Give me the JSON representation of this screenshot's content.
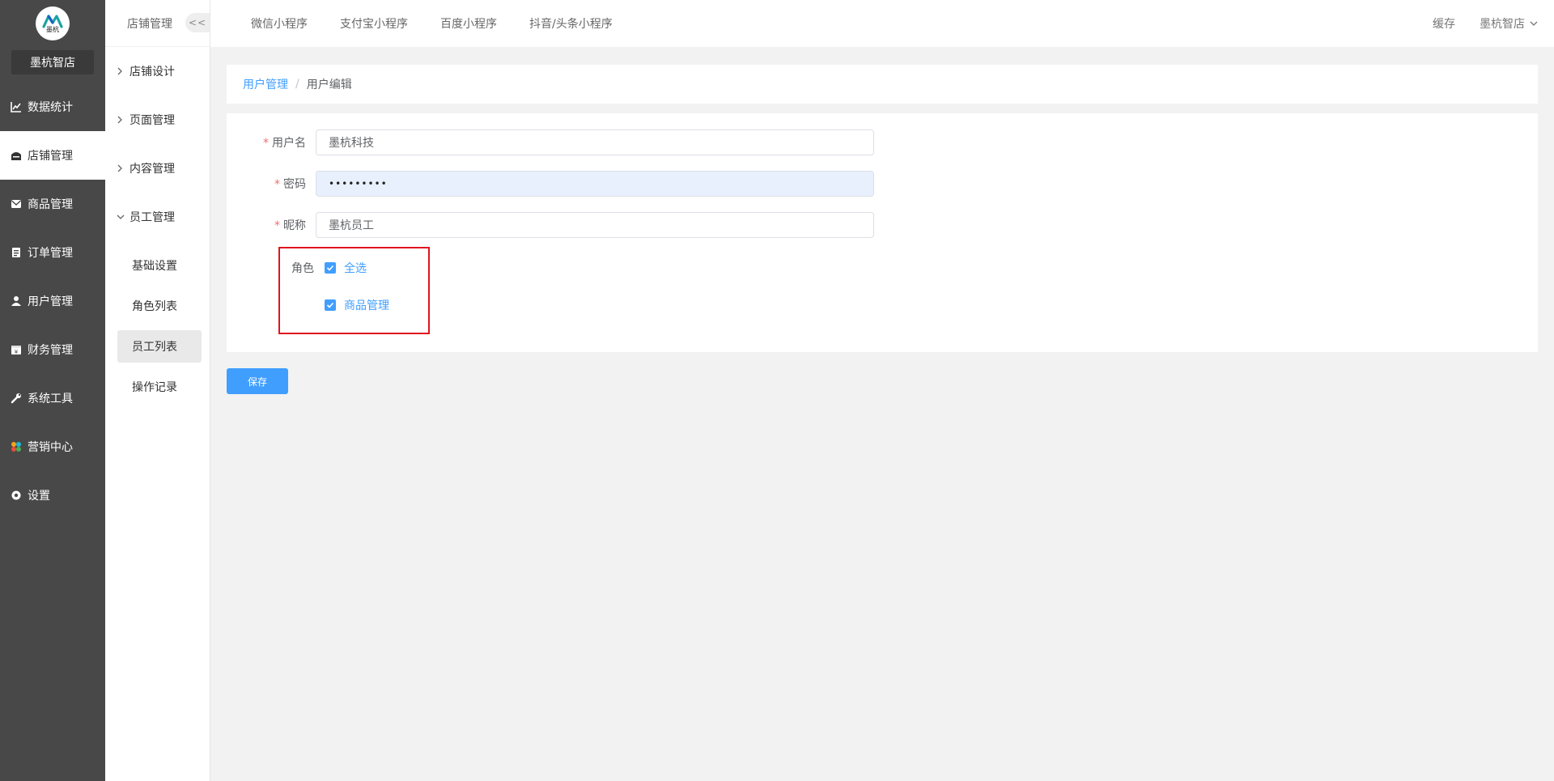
{
  "brand": {
    "logo_text": "墨杭",
    "shop_name": "墨杭智店"
  },
  "sidebar": {
    "items": [
      {
        "label": "数据统计",
        "icon": "chart-line-icon"
      },
      {
        "label": "店铺管理",
        "icon": "store-icon",
        "active": true
      },
      {
        "label": "商品管理",
        "icon": "envelope-icon"
      },
      {
        "label": "订单管理",
        "icon": "clipboard-icon"
      },
      {
        "label": "用户管理",
        "icon": "user-icon"
      },
      {
        "label": "财务管理",
        "icon": "finance-icon"
      },
      {
        "label": "系统工具",
        "icon": "wrench-icon"
      },
      {
        "label": "营销中心",
        "icon": "marketing-icon"
      },
      {
        "label": "设置",
        "icon": "gear-icon"
      }
    ]
  },
  "subbar": {
    "title": "店铺管理",
    "collapse_label": "<<",
    "groups": [
      {
        "label": "店铺设计",
        "expanded": false
      },
      {
        "label": "页面管理",
        "expanded": false
      },
      {
        "label": "内容管理",
        "expanded": false
      },
      {
        "label": "员工管理",
        "expanded": true
      }
    ],
    "children": [
      {
        "label": "基础设置"
      },
      {
        "label": "角色列表"
      },
      {
        "label": "员工列表",
        "active": true
      },
      {
        "label": "操作记录"
      }
    ]
  },
  "topbar": {
    "tabs": [
      "微信小程序",
      "支付宝小程序",
      "百度小程序",
      "抖音/头条小程序"
    ],
    "cache_label": "缓存",
    "user_label": "墨杭智店"
  },
  "breadcrumb": {
    "parent": "用户管理",
    "separator": "/",
    "current": "用户编辑"
  },
  "form": {
    "username": {
      "label": "用户名",
      "value": "墨杭科技"
    },
    "password": {
      "label": "密码",
      "value": "•••••••••"
    },
    "nickname": {
      "label": "昵称",
      "value": "墨杭员工"
    },
    "roles": {
      "label": "角色",
      "select_all": "全选",
      "options": [
        {
          "label": "商品管理",
          "checked": true
        }
      ]
    }
  },
  "actions": {
    "save_label": "保存"
  },
  "colors": {
    "primary": "#409eff",
    "sidebar_bg": "#484848",
    "highlight_border": "#e0141e",
    "required": "#f56c6c"
  }
}
